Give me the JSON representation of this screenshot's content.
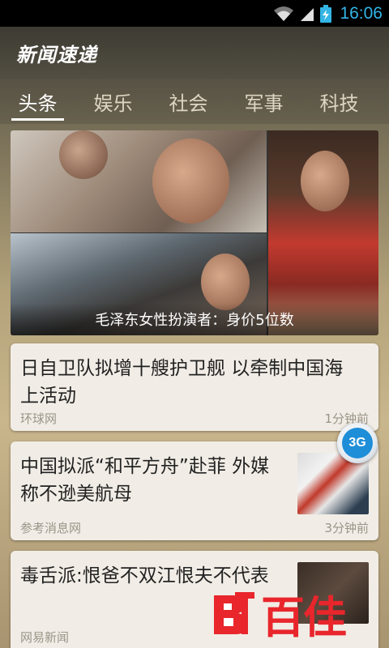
{
  "status_bar": {
    "time": "16:06",
    "icons": [
      "wifi-icon",
      "signal-icon",
      "battery-icon"
    ]
  },
  "app": {
    "title": "新闻速递"
  },
  "tabs": [
    {
      "label": "头条",
      "active": true
    },
    {
      "label": "娱乐",
      "active": false
    },
    {
      "label": "社会",
      "active": false
    },
    {
      "label": "军事",
      "active": false
    },
    {
      "label": "科技",
      "active": false
    }
  ],
  "hero": {
    "caption": "毛泽东女性扮演者：身价5位数"
  },
  "news": [
    {
      "title_line1": "日自卫队拟增十艘护卫舰 以牵制中国海",
      "title_line2": "上活动",
      "source": "环球网",
      "time": "1分钟前"
    },
    {
      "title_line1": "中国拟派“和平方舟”赴菲 外媒",
      "title_line2": "称不逊美航母",
      "source": "参考消息网",
      "time": "3分钟前"
    },
    {
      "title_line1": "毒舌派:恨爸不双江恨夫不代表",
      "title_line2": "",
      "source": "网易新闻",
      "time": ""
    }
  ],
  "floating_badge": {
    "label": "3G"
  },
  "watermark": {
    "text": "百佳"
  },
  "colors": {
    "accent_time": "#33b5e5",
    "badge_blue": "#1f8ed8",
    "watermark_red": "#e8262c"
  }
}
